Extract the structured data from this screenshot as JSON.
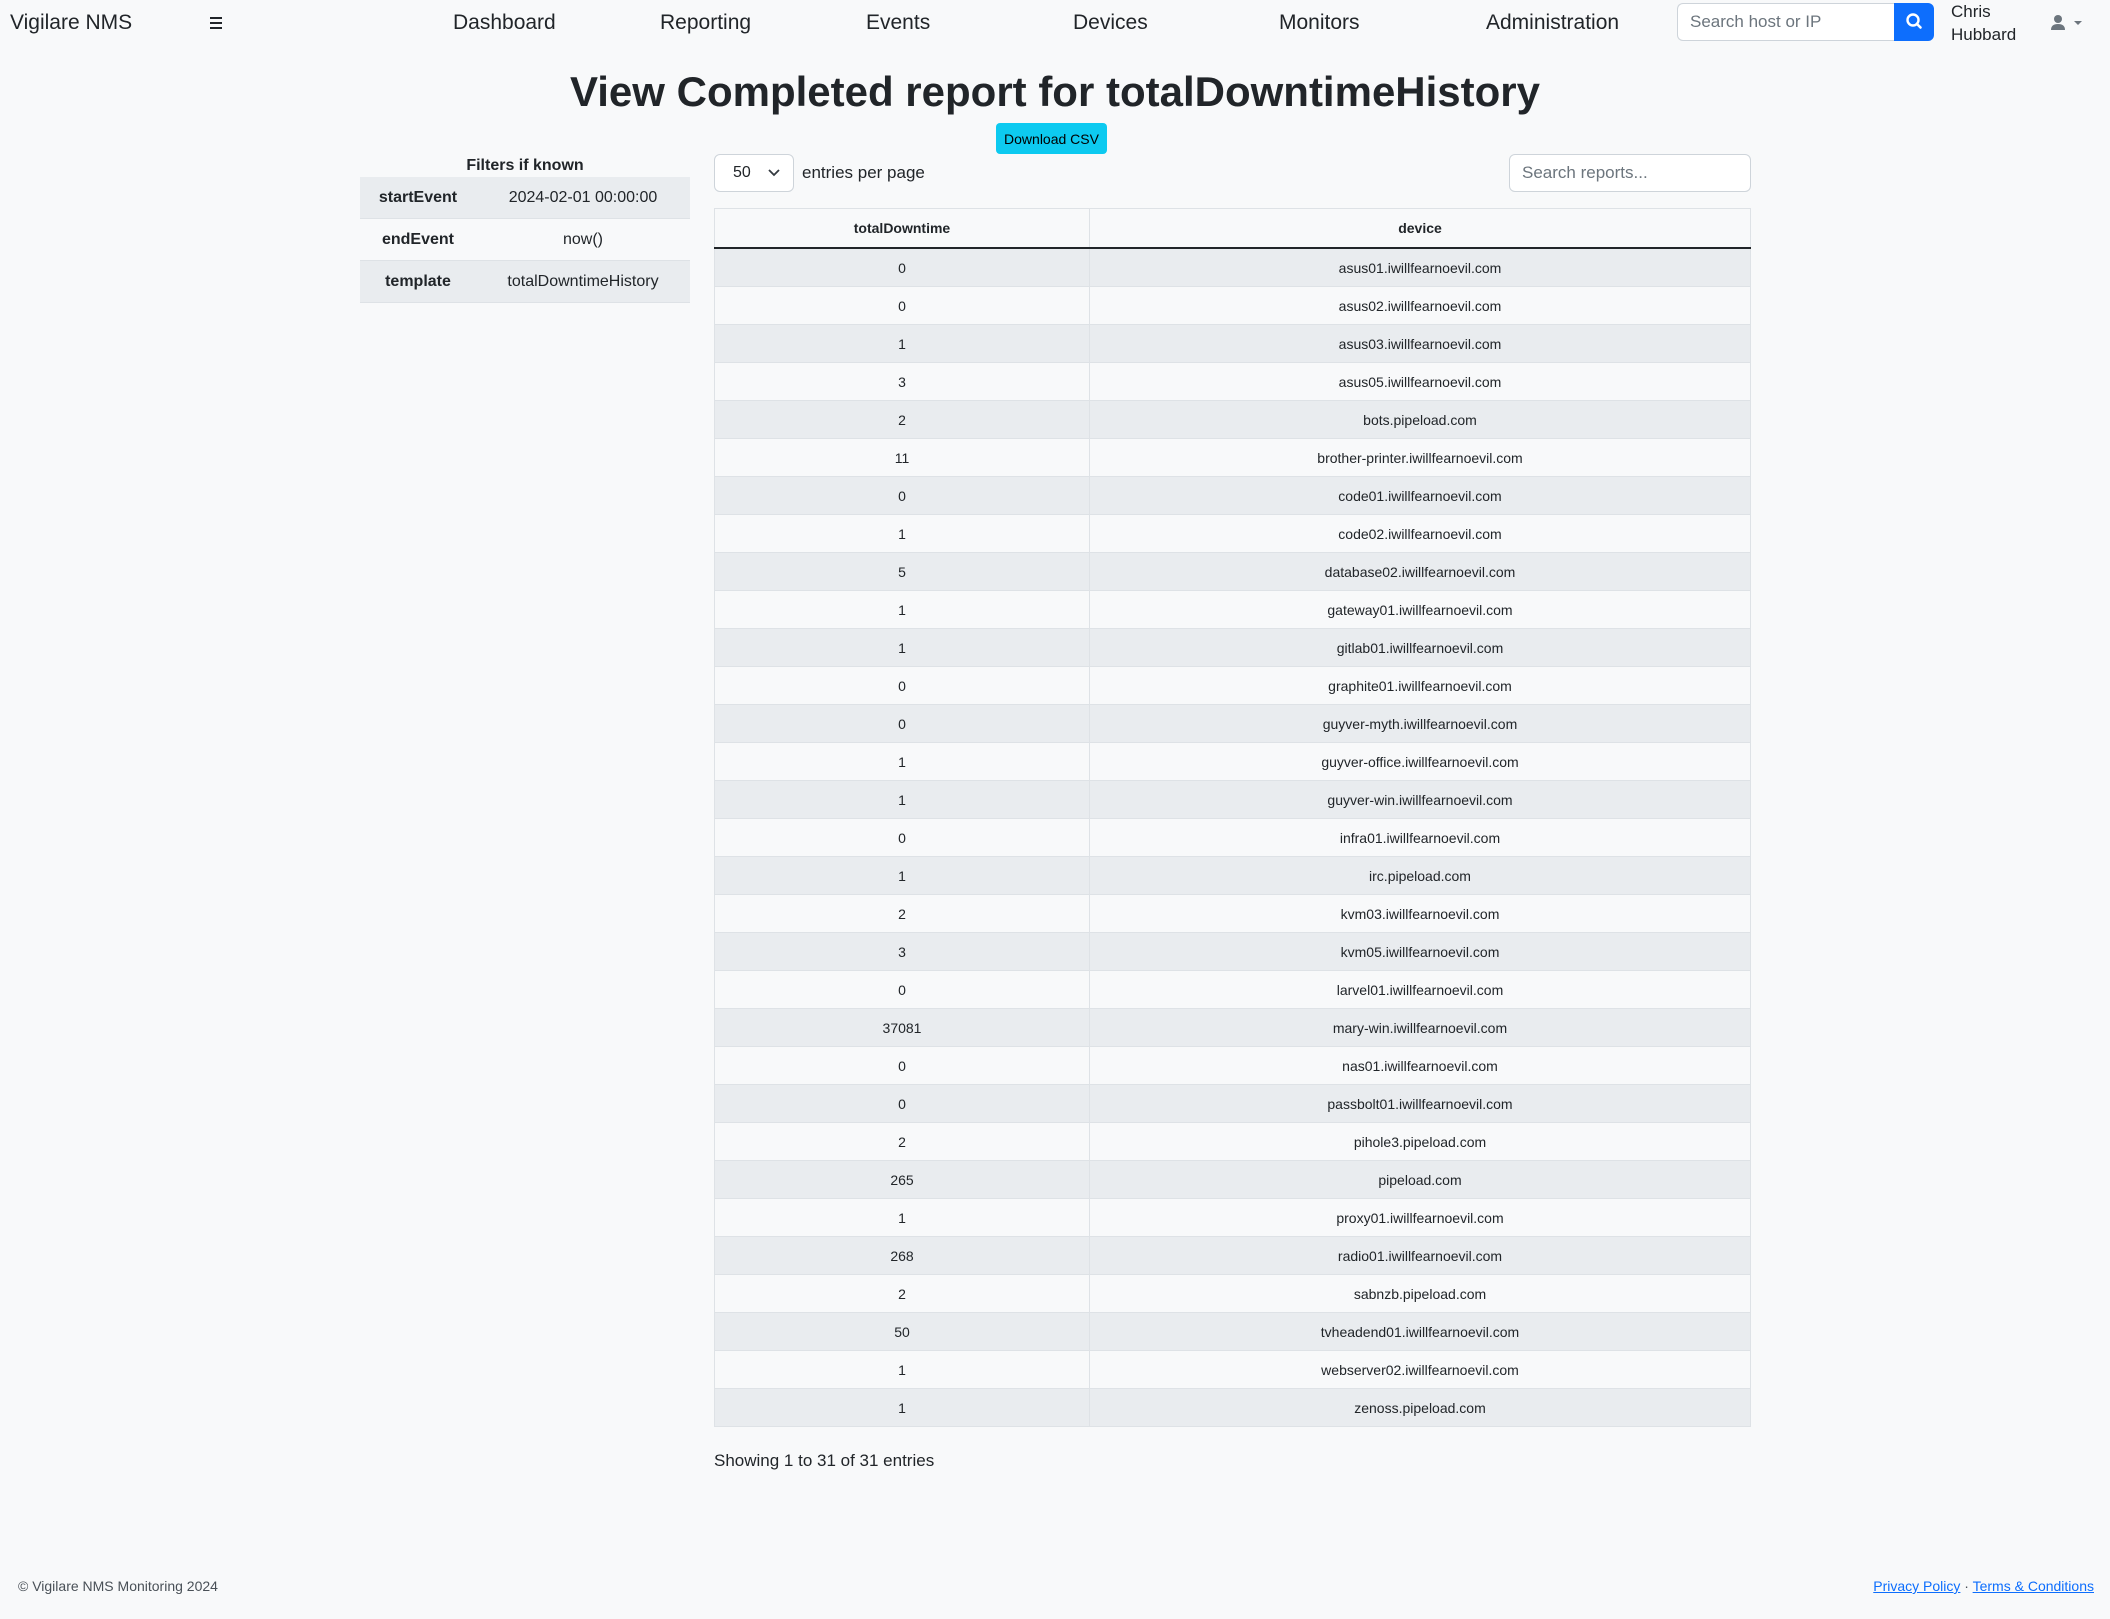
{
  "navbar": {
    "brand": "Vigilare NMS",
    "links": [
      "Dashboard",
      "Reporting",
      "Events",
      "Devices",
      "Monitors",
      "Administration"
    ],
    "search_placeholder": "Search host or IP",
    "user_first": "Chris",
    "user_last": "Hubbard"
  },
  "page": {
    "title": "View Completed report for totalDowntimeHistory",
    "download_label": "Download CSV"
  },
  "filters": {
    "title": "Filters if known",
    "rows": [
      {
        "key": "startEvent",
        "value": "2024-02-01 00:00:00"
      },
      {
        "key": "endEvent",
        "value": "now()"
      },
      {
        "key": "template",
        "value": "totalDowntimeHistory"
      }
    ]
  },
  "table_controls": {
    "per_page_value": "50",
    "per_page_label": "entries per page",
    "search_placeholder": "Search reports..."
  },
  "table": {
    "columns": [
      "totalDowntime",
      "device"
    ],
    "rows": [
      [
        "0",
        "asus01.iwillfearnoevil.com"
      ],
      [
        "0",
        "asus02.iwillfearnoevil.com"
      ],
      [
        "1",
        "asus03.iwillfearnoevil.com"
      ],
      [
        "3",
        "asus05.iwillfearnoevil.com"
      ],
      [
        "2",
        "bots.pipeload.com"
      ],
      [
        "11",
        "brother-printer.iwillfearnoevil.com"
      ],
      [
        "0",
        "code01.iwillfearnoevil.com"
      ],
      [
        "1",
        "code02.iwillfearnoevil.com"
      ],
      [
        "5",
        "database02.iwillfearnoevil.com"
      ],
      [
        "1",
        "gateway01.iwillfearnoevil.com"
      ],
      [
        "1",
        "gitlab01.iwillfearnoevil.com"
      ],
      [
        "0",
        "graphite01.iwillfearnoevil.com"
      ],
      [
        "0",
        "guyver-myth.iwillfearnoevil.com"
      ],
      [
        "1",
        "guyver-office.iwillfearnoevil.com"
      ],
      [
        "1",
        "guyver-win.iwillfearnoevil.com"
      ],
      [
        "0",
        "infra01.iwillfearnoevil.com"
      ],
      [
        "1",
        "irc.pipeload.com"
      ],
      [
        "2",
        "kvm03.iwillfearnoevil.com"
      ],
      [
        "3",
        "kvm05.iwillfearnoevil.com"
      ],
      [
        "0",
        "larvel01.iwillfearnoevil.com"
      ],
      [
        "37081",
        "mary-win.iwillfearnoevil.com"
      ],
      [
        "0",
        "nas01.iwillfearnoevil.com"
      ],
      [
        "0",
        "passbolt01.iwillfearnoevil.com"
      ],
      [
        "2",
        "pihole3.pipeload.com"
      ],
      [
        "265",
        "pipeload.com"
      ],
      [
        "1",
        "proxy01.iwillfearnoevil.com"
      ],
      [
        "268",
        "radio01.iwillfearnoevil.com"
      ],
      [
        "2",
        "sabnzb.pipeload.com"
      ],
      [
        "50",
        "tvheadend01.iwillfearnoevil.com"
      ],
      [
        "1",
        "webserver02.iwillfearnoevil.com"
      ],
      [
        "1",
        "zenoss.pipeload.com"
      ]
    ],
    "info": "Showing 1 to 31 of 31 entries"
  },
  "footer": {
    "copyright": "© Vigilare NMS Monitoring 2024",
    "separator": "·",
    "privacy": "Privacy Policy",
    "terms": "Terms & Conditions"
  },
  "colors": {
    "primary": "#0d6efd",
    "info_button": "#0dcaf0",
    "stripe": "#e9ecef",
    "background": "#f8f9fa"
  },
  "icons": [
    "hamburger-icon",
    "search-icon",
    "user-icon",
    "caret-down-icon",
    "chevron-down-icon"
  ]
}
